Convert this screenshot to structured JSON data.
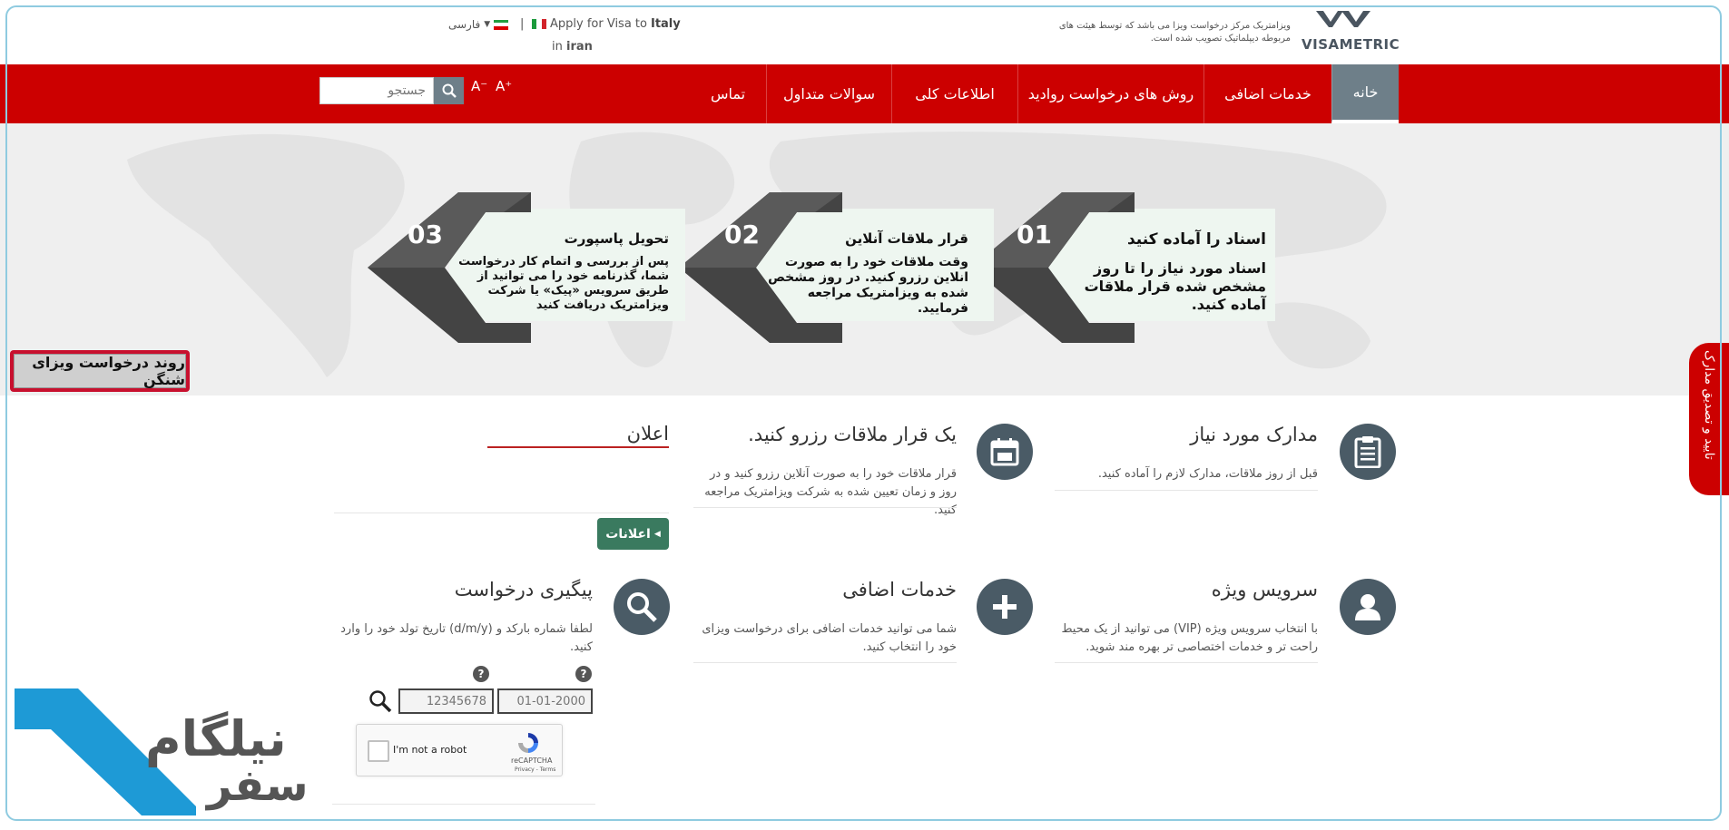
{
  "header": {
    "logo_text": "VISAMETRIC",
    "logo_description": "ویزامتریک مرکز درخواست ویزا می باشد که توسط هیئت های مربوطه دیپلماتیک تصویب شده است.",
    "apply_prefix": "Apply for Visa to",
    "apply_country": "Italy",
    "in_prefix": "in",
    "in_country": "iran",
    "separator": "|",
    "language": "فارسی"
  },
  "nav": {
    "items": [
      {
        "label": "خانه"
      },
      {
        "label": "خدمات اضافی"
      },
      {
        "label": "روش های درخواست روادید"
      },
      {
        "label": "اطلاعات کلی"
      },
      {
        "label": "سوالات متداول"
      },
      {
        "label": "تماس"
      }
    ],
    "search_placeholder": "جستجو",
    "font_smaller": "A⁻",
    "font_larger": "A⁺"
  },
  "steps": [
    {
      "num": "01",
      "title": "اسناد را آماده کنید",
      "body": "اسناد مورد نیاز را تا روز مشخص شده قرار ملاقات آماده کنید."
    },
    {
      "num": "02",
      "title": "قرار ملاقات آنلاین",
      "body": "وقت ملاقات خود را به صورت انلاین رزرو کنید. در روز مشخص شده به ویزامتریک مراجعه فرمایید."
    },
    {
      "num": "03",
      "title": "تحویل پاسپورت",
      "body": "پس از بررسی و اتمام کار درخواست شما، گذرنامه خود را می توانید از طریق سرویس «پیک» یا شرکت ویزامتریک دریافت کنید"
    }
  ],
  "shengen_button": "روند درخواست ویزای شنگن",
  "side_tab": "تایید و تصدیق مدارک",
  "sections": {
    "documents": {
      "title": "مدارک مورد نیاز",
      "body": "قبل از روز ملاقات، مدارک لازم را آماده کنید."
    },
    "appointment": {
      "title": "یک قرار ملاقات رزرو کنید.",
      "body": "قرار ملاقات خود را به صورت آنلاین رزرو کنید و در روز و زمان تعیین شده به شرکت ویزامتریک مراجعه کنید."
    },
    "announcements": {
      "title": "اعلان",
      "button": "اعلانات"
    },
    "vip": {
      "title": "سرویس ویژه",
      "body": "با انتخاب سرویس ویژه (VIP) می توانید از یک محیط راحت تر و خدمات اختصاصی تر بهره مند شوید."
    },
    "extra": {
      "title": "خدمات اضافی",
      "body": "شما می توانید خدمات اضافی برای درخواست ویزای خود را انتخاب کنید."
    },
    "tracking": {
      "title": "پیگیری درخواست",
      "body": "لطفا شماره بارکد و (d/m/y) تاریخ تولد خود را وارد کنید.",
      "barcode_placeholder": "12345678",
      "date_placeholder": "01-01-2000",
      "help": "?"
    }
  },
  "captcha": {
    "label": "I'm not a robot",
    "brand": "reCAPTCHA",
    "terms": "Privacy - Terms"
  },
  "watermark": {
    "line1": "نیلگام",
    "line2": "سفر"
  },
  "colors": {
    "nav": "#cc0000",
    "nav_active": "#6e7f89",
    "icon_circle": "#4a5b66",
    "announce_button": "#3a7a5f",
    "watermark_blue": "#1e9ad6"
  }
}
